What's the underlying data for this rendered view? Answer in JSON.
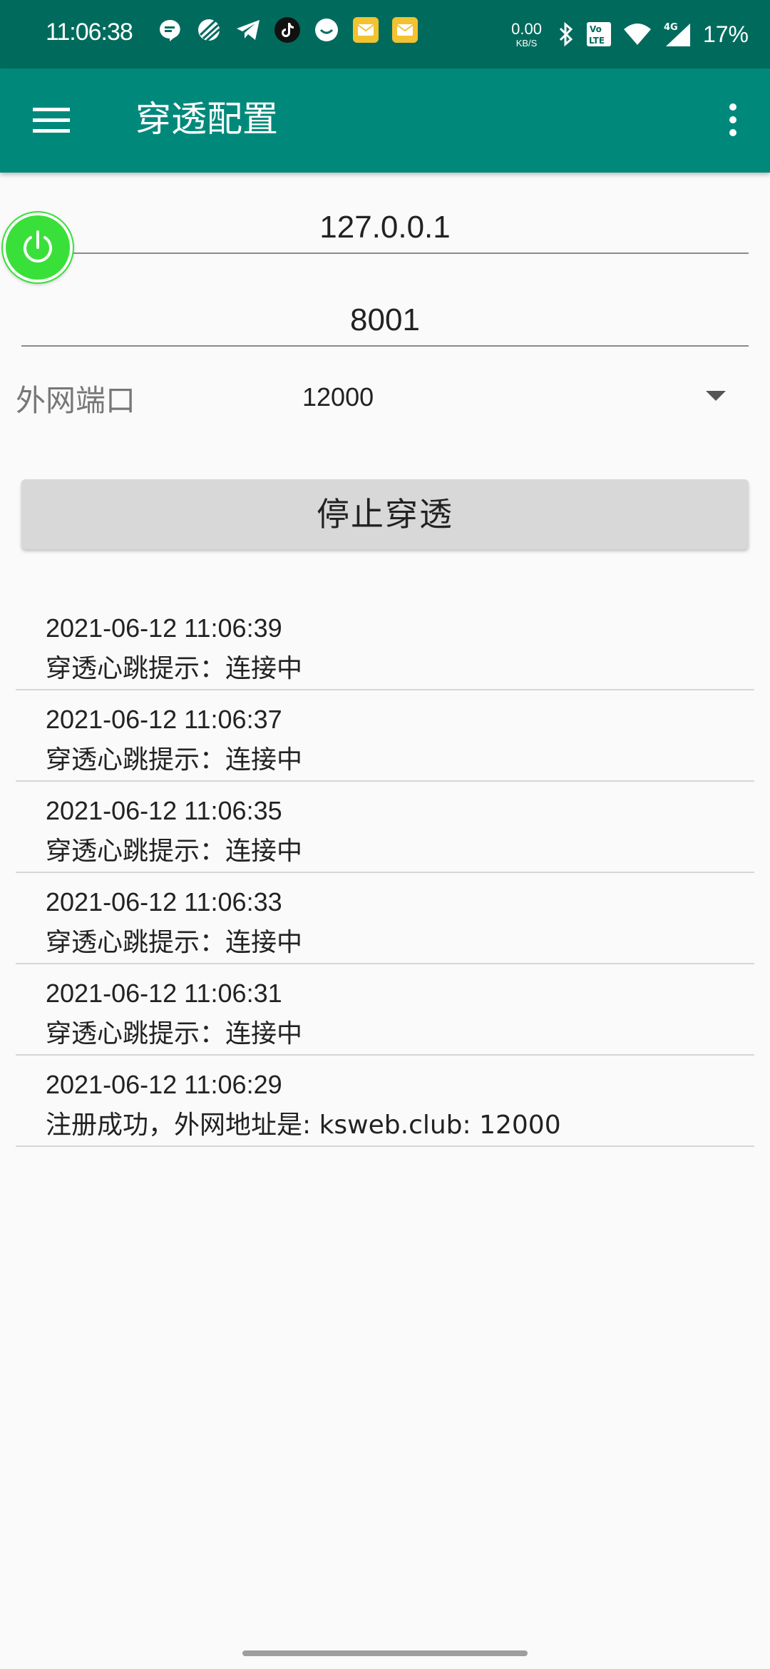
{
  "status_bar": {
    "time": "11:06:38",
    "net_speed_value": "0.00",
    "net_speed_unit": "KB/S",
    "network_type": "4G",
    "volte_label": "Vo LTE",
    "battery": "17%",
    "notification_icons": [
      "message-icon",
      "planet-app-icon",
      "telegram-icon",
      "tiktok-icon",
      "clock-app-icon",
      "mail-icon",
      "mail-icon"
    ]
  },
  "toolbar": {
    "title": "穿透配置"
  },
  "form": {
    "ip_value": "127.0.0.1",
    "port_value": "8001",
    "ext_port_label": "外网端口",
    "ext_port_value": "12000",
    "stop_button_label": "停止穿透"
  },
  "colors": {
    "status_bar": "#006b5c",
    "toolbar": "#00897b",
    "power_button": "#3ae03a",
    "button_bg": "#d8d8d8"
  },
  "log": [
    {
      "time": "2021-06-12 11:06:39",
      "message": "穿透心跳提示：连接中"
    },
    {
      "time": "2021-06-12 11:06:37",
      "message": "穿透心跳提示：连接中"
    },
    {
      "time": "2021-06-12 11:06:35",
      "message": "穿透心跳提示：连接中"
    },
    {
      "time": "2021-06-12 11:06:33",
      "message": "穿透心跳提示：连接中"
    },
    {
      "time": "2021-06-12 11:06:31",
      "message": "穿透心跳提示：连接中"
    },
    {
      "time": "2021-06-12 11:06:29",
      "message": "注册成功，外网地址是:  ksweb.club: 12000"
    }
  ]
}
